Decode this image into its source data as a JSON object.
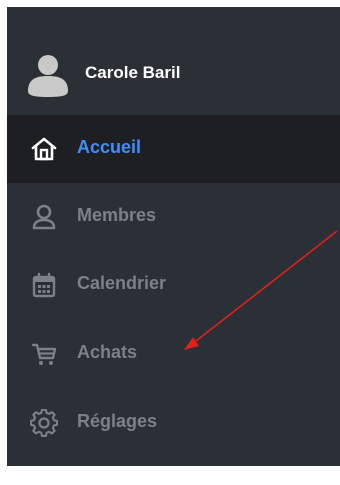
{
  "user": {
    "name": "Carole Baril",
    "avatar_icon": "user-avatar-icon"
  },
  "nav": {
    "items": [
      {
        "label": "Accueil",
        "icon": "home-icon",
        "active": true
      },
      {
        "label": "Membres",
        "icon": "user-icon",
        "active": false
      },
      {
        "label": "Calendrier",
        "icon": "calendar-icon",
        "active": false
      },
      {
        "label": "Achats",
        "icon": "cart-icon",
        "active": false
      },
      {
        "label": "Réglages",
        "icon": "gear-icon",
        "active": false
      }
    ]
  },
  "colors": {
    "sidebar_bg": "#2b2f36",
    "active_bg": "#1d1f23",
    "active_text": "#3f8efc",
    "inactive_text": "#7b8089",
    "annotation_arrow": "#e0201b"
  }
}
